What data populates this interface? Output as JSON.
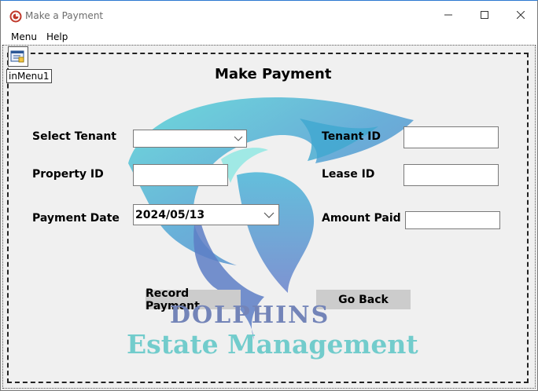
{
  "window": {
    "title": "Make a Payment",
    "icons": {
      "app": "app-logo-icon",
      "minimize": "minimize-icon",
      "maximize": "maximize-icon",
      "close": "close-icon"
    }
  },
  "menubar": {
    "menu_label": "Menu",
    "help_label": "Help"
  },
  "designer": {
    "component_label": "inMenu1",
    "component_icon": "menu-component-icon"
  },
  "form": {
    "heading": "Make Payment",
    "select_tenant_label": "Select Tenant",
    "property_id_label": "Property ID",
    "payment_date_label": "Payment Date",
    "tenant_id_label": "Tenant ID",
    "lease_id_label": "Lease ID",
    "amount_paid_label": "Amount Paid",
    "select_tenant_value": "",
    "property_id_value": "",
    "payment_date_value": "2024/05/13",
    "tenant_id_value": "",
    "lease_id_value": "",
    "amount_paid_value": ""
  },
  "buttons": {
    "record_payment": "Record Payment",
    "go_back": "Go Back"
  },
  "branding": {
    "line1": "DOLPHINS",
    "line2": "Estate Management",
    "line1_color": "#7384b8",
    "line2_color": "#72cccc"
  },
  "colors": {
    "window_bg": "#f0f0f0",
    "button_bg": "#cccccc",
    "title_accent": "#c0392b"
  }
}
